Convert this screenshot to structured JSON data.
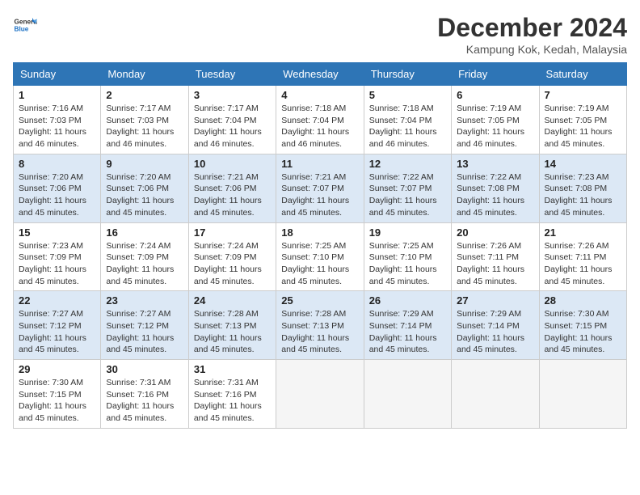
{
  "header": {
    "logo": {
      "general": "General",
      "blue": "Blue"
    },
    "title": "December 2024",
    "location": "Kampung Kok, Kedah, Malaysia"
  },
  "columns": [
    "Sunday",
    "Monday",
    "Tuesday",
    "Wednesday",
    "Thursday",
    "Friday",
    "Saturday"
  ],
  "weeks": [
    [
      {
        "day": "1",
        "sunrise": "7:16 AM",
        "sunset": "7:03 PM",
        "daylight": "11 hours and 46 minutes."
      },
      {
        "day": "2",
        "sunrise": "7:17 AM",
        "sunset": "7:03 PM",
        "daylight": "11 hours and 46 minutes."
      },
      {
        "day": "3",
        "sunrise": "7:17 AM",
        "sunset": "7:04 PM",
        "daylight": "11 hours and 46 minutes."
      },
      {
        "day": "4",
        "sunrise": "7:18 AM",
        "sunset": "7:04 PM",
        "daylight": "11 hours and 46 minutes."
      },
      {
        "day": "5",
        "sunrise": "7:18 AM",
        "sunset": "7:04 PM",
        "daylight": "11 hours and 46 minutes."
      },
      {
        "day": "6",
        "sunrise": "7:19 AM",
        "sunset": "7:05 PM",
        "daylight": "11 hours and 46 minutes."
      },
      {
        "day": "7",
        "sunrise": "7:19 AM",
        "sunset": "7:05 PM",
        "daylight": "11 hours and 45 minutes."
      }
    ],
    [
      {
        "day": "8",
        "sunrise": "7:20 AM",
        "sunset": "7:06 PM",
        "daylight": "11 hours and 45 minutes."
      },
      {
        "day": "9",
        "sunrise": "7:20 AM",
        "sunset": "7:06 PM",
        "daylight": "11 hours and 45 minutes."
      },
      {
        "day": "10",
        "sunrise": "7:21 AM",
        "sunset": "7:06 PM",
        "daylight": "11 hours and 45 minutes."
      },
      {
        "day": "11",
        "sunrise": "7:21 AM",
        "sunset": "7:07 PM",
        "daylight": "11 hours and 45 minutes."
      },
      {
        "day": "12",
        "sunrise": "7:22 AM",
        "sunset": "7:07 PM",
        "daylight": "11 hours and 45 minutes."
      },
      {
        "day": "13",
        "sunrise": "7:22 AM",
        "sunset": "7:08 PM",
        "daylight": "11 hours and 45 minutes."
      },
      {
        "day": "14",
        "sunrise": "7:23 AM",
        "sunset": "7:08 PM",
        "daylight": "11 hours and 45 minutes."
      }
    ],
    [
      {
        "day": "15",
        "sunrise": "7:23 AM",
        "sunset": "7:09 PM",
        "daylight": "11 hours and 45 minutes."
      },
      {
        "day": "16",
        "sunrise": "7:24 AM",
        "sunset": "7:09 PM",
        "daylight": "11 hours and 45 minutes."
      },
      {
        "day": "17",
        "sunrise": "7:24 AM",
        "sunset": "7:09 PM",
        "daylight": "11 hours and 45 minutes."
      },
      {
        "day": "18",
        "sunrise": "7:25 AM",
        "sunset": "7:10 PM",
        "daylight": "11 hours and 45 minutes."
      },
      {
        "day": "19",
        "sunrise": "7:25 AM",
        "sunset": "7:10 PM",
        "daylight": "11 hours and 45 minutes."
      },
      {
        "day": "20",
        "sunrise": "7:26 AM",
        "sunset": "7:11 PM",
        "daylight": "11 hours and 45 minutes."
      },
      {
        "day": "21",
        "sunrise": "7:26 AM",
        "sunset": "7:11 PM",
        "daylight": "11 hours and 45 minutes."
      }
    ],
    [
      {
        "day": "22",
        "sunrise": "7:27 AM",
        "sunset": "7:12 PM",
        "daylight": "11 hours and 45 minutes."
      },
      {
        "day": "23",
        "sunrise": "7:27 AM",
        "sunset": "7:12 PM",
        "daylight": "11 hours and 45 minutes."
      },
      {
        "day": "24",
        "sunrise": "7:28 AM",
        "sunset": "7:13 PM",
        "daylight": "11 hours and 45 minutes."
      },
      {
        "day": "25",
        "sunrise": "7:28 AM",
        "sunset": "7:13 PM",
        "daylight": "11 hours and 45 minutes."
      },
      {
        "day": "26",
        "sunrise": "7:29 AM",
        "sunset": "7:14 PM",
        "daylight": "11 hours and 45 minutes."
      },
      {
        "day": "27",
        "sunrise": "7:29 AM",
        "sunset": "7:14 PM",
        "daylight": "11 hours and 45 minutes."
      },
      {
        "day": "28",
        "sunrise": "7:30 AM",
        "sunset": "7:15 PM",
        "daylight": "11 hours and 45 minutes."
      }
    ],
    [
      {
        "day": "29",
        "sunrise": "7:30 AM",
        "sunset": "7:15 PM",
        "daylight": "11 hours and 45 minutes."
      },
      {
        "day": "30",
        "sunrise": "7:31 AM",
        "sunset": "7:16 PM",
        "daylight": "11 hours and 45 minutes."
      },
      {
        "day": "31",
        "sunrise": "7:31 AM",
        "sunset": "7:16 PM",
        "daylight": "11 hours and 45 minutes."
      },
      null,
      null,
      null,
      null
    ]
  ],
  "labels": {
    "sunrise": "Sunrise:",
    "sunset": "Sunset:",
    "daylight": "Daylight:"
  }
}
